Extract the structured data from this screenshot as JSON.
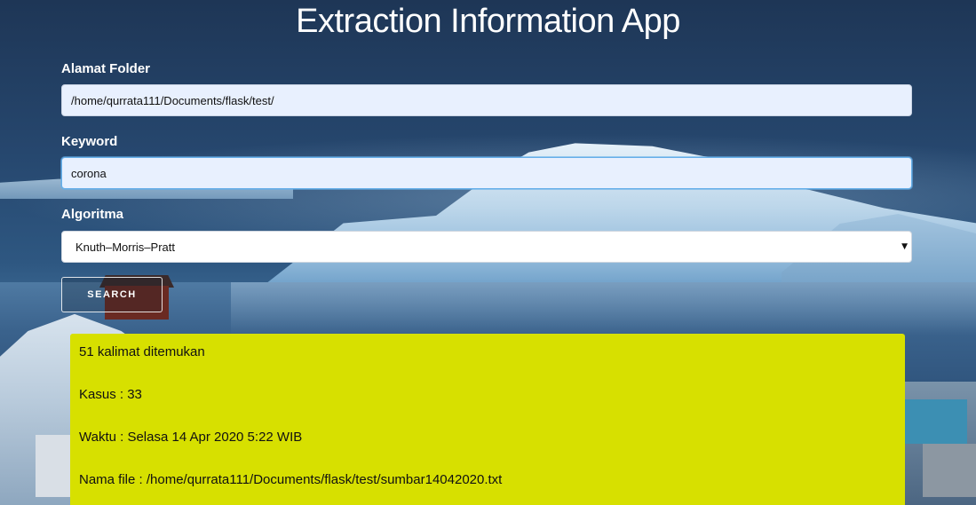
{
  "app": {
    "title": "Extraction Information App"
  },
  "form": {
    "folder": {
      "label": "Alamat Folder",
      "value": "/home/qurrata111/Documents/flask/test/"
    },
    "keyword": {
      "label": "Keyword",
      "value": "corona"
    },
    "algorithm": {
      "label": "Algoritma",
      "selected": "Knuth–Morris–Pratt"
    },
    "search_button": {
      "label": "SEARCH"
    }
  },
  "result": {
    "summary": "51 kalimat ditemukan",
    "cases": "Kasus : 33",
    "time": "Waktu : Selasa 14 Apr 2020 5:22 WIB",
    "file": "Nama file : /home/qurrata111/Documents/flask/test/sumbar14042020.txt"
  },
  "colors": {
    "result_background": "#d7e000",
    "input_background": "#e8f0fe",
    "focus_border": "#66afe9",
    "text_light": "#ffffff"
  },
  "icons": {
    "select_caret": "caret-down-icon"
  }
}
